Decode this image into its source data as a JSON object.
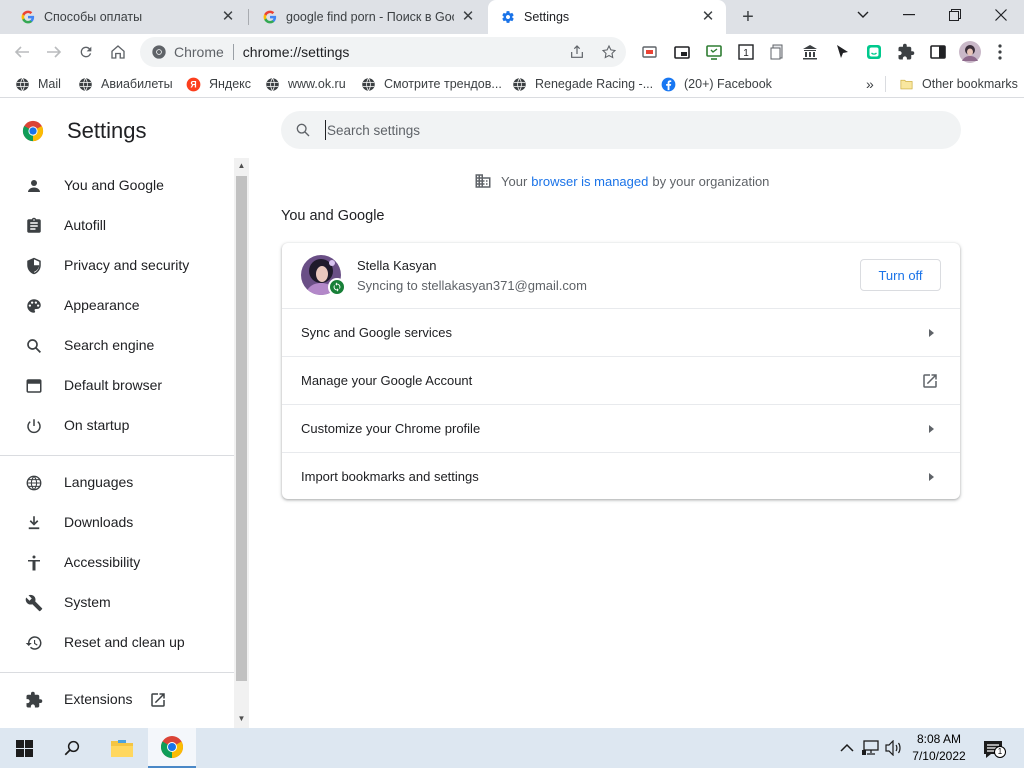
{
  "tabs": [
    {
      "title": "Способы оплаты",
      "favicon": "google-g-icon",
      "active": false
    },
    {
      "title": "google find porn - Поиск в Google",
      "favicon": "google-g-icon",
      "active": false
    },
    {
      "title": "Settings",
      "favicon": "settings-gear-icon",
      "active": true
    }
  ],
  "omnibox": {
    "site_label": "Chrome",
    "url": "chrome://settings"
  },
  "bookmarks": [
    {
      "label": "Mail",
      "icon": "globe-icon"
    },
    {
      "label": "Авиабилеты",
      "icon": "globe-icon"
    },
    {
      "label": "Яндекс",
      "icon": "yandex-icon"
    },
    {
      "label": "www.ok.ru",
      "icon": "globe-icon"
    },
    {
      "label": "Смотрите трендов...",
      "icon": "globe-icon"
    },
    {
      "label": "Renegade Racing -...",
      "icon": "globe-icon"
    },
    {
      "label": "(20+) Facebook",
      "icon": "facebook-icon"
    }
  ],
  "bookmarks_more": "»",
  "other_bookmarks": "Other bookmarks",
  "settings": {
    "title": "Settings",
    "search_placeholder": "Search settings",
    "sidebar": [
      {
        "label": "You and Google",
        "icon": "person-icon"
      },
      {
        "label": "Autofill",
        "icon": "clipboard-icon"
      },
      {
        "label": "Privacy and security",
        "icon": "shield-icon"
      },
      {
        "label": "Appearance",
        "icon": "palette-icon"
      },
      {
        "label": "Search engine",
        "icon": "search-icon"
      },
      {
        "label": "Default browser",
        "icon": "browser-window-icon"
      },
      {
        "label": "On startup",
        "icon": "power-icon"
      },
      {
        "label": "Languages",
        "icon": "globe-icon"
      },
      {
        "label": "Downloads",
        "icon": "download-icon"
      },
      {
        "label": "Accessibility",
        "icon": "accessibility-icon"
      },
      {
        "label": "System",
        "icon": "wrench-icon"
      },
      {
        "label": "Reset and clean up",
        "icon": "history-icon"
      },
      {
        "label": "Extensions",
        "icon": "puzzle-icon"
      }
    ],
    "managed": {
      "prefix": "Your",
      "link": "browser is managed",
      "suffix": "by your organization"
    },
    "section_title": "You and Google",
    "profile": {
      "name": "Stella Kasyan",
      "status": "Syncing to stellakasyan371@gmail.com",
      "button": "Turn off"
    },
    "rows": [
      {
        "label": "Sync and Google services"
      },
      {
        "label": "Manage your Google Account"
      },
      {
        "label": "Customize your Chrome profile"
      },
      {
        "label": "Import bookmarks and settings"
      }
    ]
  },
  "taskbar": {
    "time": "8:08 AM",
    "date": "7/10/2022",
    "notifications": "1"
  },
  "colors": {
    "accent": "#1a73e8",
    "tabstrip": "#dee1e6",
    "taskbar": "#dde7f1",
    "sync_green": "#188038"
  }
}
